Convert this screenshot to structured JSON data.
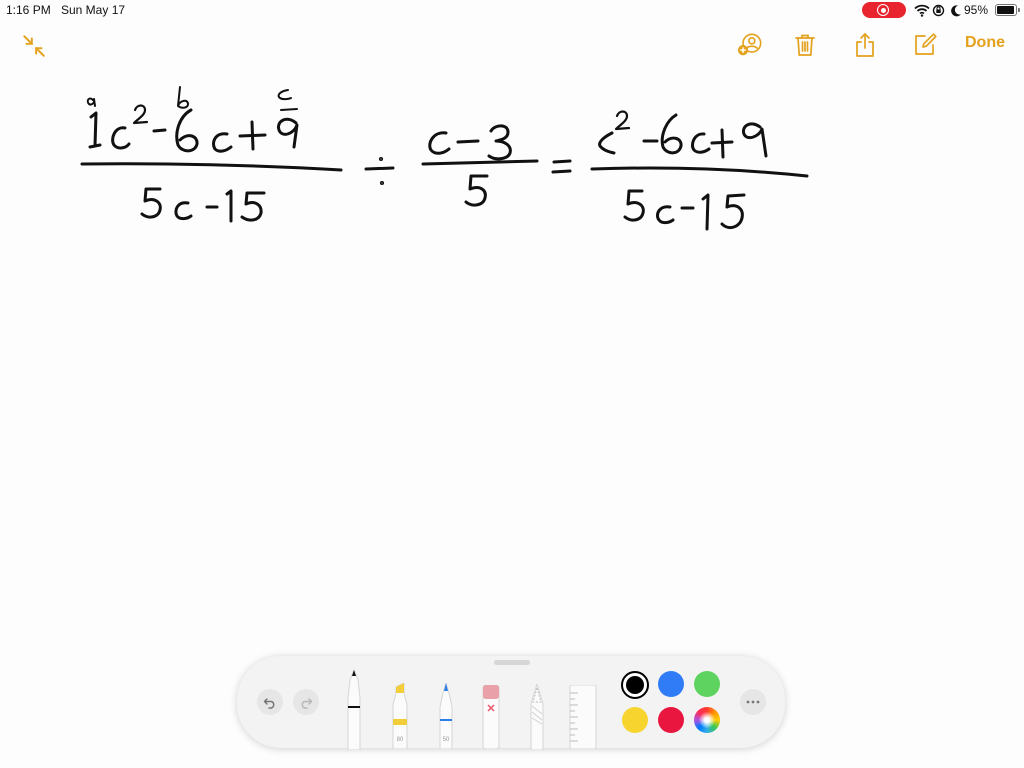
{
  "status_bar": {
    "time": "1:16 PM",
    "date": "Sun May 17",
    "battery_text": "95%",
    "battery_level": 0.95,
    "record_color": "#e8242f"
  },
  "toolbar": {
    "collapse_icon": "arrows-in-icon",
    "icons": [
      "add-person-icon",
      "trash-icon",
      "share-icon",
      "compose-icon"
    ],
    "done_label": "Done",
    "accent_color": "#e3a11c"
  },
  "drawing": {
    "ink_color": "#111111",
    "handwritten_expression": {
      "left_numerator": "1c² - 6c + 9",
      "left_numerator_annotations": [
        "a",
        "b",
        "c"
      ],
      "left_denominator": "5c - 15",
      "operator": "÷",
      "middle_numerator": "c - 3",
      "middle_denominator": "5",
      "equals": "=",
      "right_numerator": "c² - 6c + 9",
      "right_denominator": "5c - 15"
    }
  },
  "palette": {
    "tools": [
      {
        "name": "pen",
        "tip_color": "#111111",
        "label": ""
      },
      {
        "name": "highlighter",
        "tip_color": "#f2cf3a",
        "label": "80"
      },
      {
        "name": "marker",
        "tip_color": "#2b7de9",
        "label": "50"
      },
      {
        "name": "eraser",
        "tip_color": "#e9a0a8",
        "label": ""
      },
      {
        "name": "lasso",
        "tip_color": "#cccccc",
        "label": ""
      },
      {
        "name": "ruler",
        "tip_color": "#dddddd",
        "label": ""
      }
    ],
    "colors": [
      "#000000",
      "#2f7cf6",
      "#5ed35f",
      "#f8d42f",
      "#e9163f",
      "spectrum"
    ],
    "selected_color": "#000000"
  }
}
